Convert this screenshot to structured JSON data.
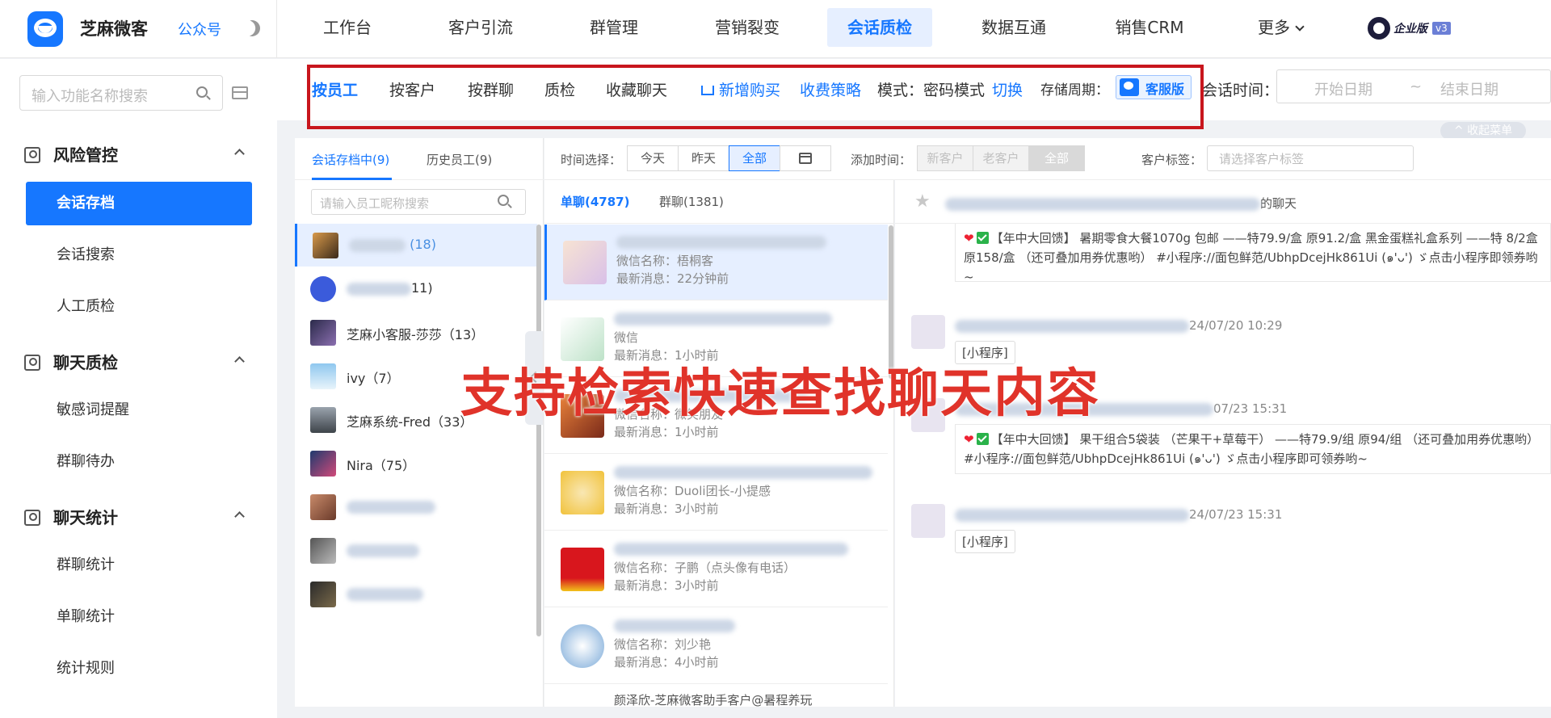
{
  "brand": {
    "name": "芝麻微客",
    "sub": "公众号"
  },
  "nav": {
    "items": [
      "工作台",
      "客户引流",
      "群管理",
      "营销裂变",
      "会话质检",
      "数据互通",
      "销售CRM",
      "更多"
    ],
    "active": "会话质检",
    "edition": "企业版",
    "version": "v3"
  },
  "sidebar": {
    "search_placeholder": "输入功能名称搜索",
    "sections": [
      {
        "title": "风险管控",
        "items": [
          "会话存档",
          "会话搜索",
          "人工质检"
        ]
      },
      {
        "title": "聊天质检",
        "items": [
          "敏感词提醒",
          "群聊待办"
        ]
      },
      {
        "title": "聊天统计",
        "items": [
          "群聊统计",
          "单聊统计",
          "统计规则"
        ]
      }
    ],
    "active_item": "会话存档"
  },
  "filterbar": {
    "tabs": [
      "按员工",
      "按客户",
      "按群聊",
      "质检",
      "收藏聊天"
    ],
    "active_tab": "按员工",
    "buy": "新增购买",
    "strategy": "收费策略",
    "mode_label": "模式：",
    "mode_value": "密码模式",
    "switch": "切换",
    "storage_label": "存储周期：",
    "storage_value": "客服版",
    "time_label": "会话时间：",
    "start_placeholder": "开始日期",
    "range_sep": "~",
    "end_placeholder": "结束日期",
    "collapse": "^ 收起菜单"
  },
  "staff": {
    "tabs": [
      "会话存档中(9)",
      "历史员工(9)"
    ],
    "search_placeholder": "请输入员工昵称搜索",
    "list": [
      {
        "name": "",
        "count": "(18)"
      },
      {
        "name": "",
        "count": "11)"
      },
      {
        "name": "芝麻小客服-莎莎",
        "count": "（13）"
      },
      {
        "name": "ivy",
        "count": "（7）"
      },
      {
        "name": "芝麻系统-Fred",
        "count": "（33）"
      },
      {
        "name": "Nira",
        "count": "（75）"
      },
      {
        "name": "",
        "count": ""
      },
      {
        "name": "",
        "count": ""
      },
      {
        "name": "",
        "count": ""
      }
    ]
  },
  "timebar": {
    "label": "时间选择：",
    "options": [
      "今天",
      "昨天",
      "全部"
    ],
    "active": "全部",
    "add_label": "添加时间：",
    "add_options": [
      "新客户",
      "老客户",
      "全部"
    ],
    "tag_label": "客户标签：",
    "tag_placeholder": "请选择客户标签"
  },
  "chats": {
    "tabs": [
      "单聊(4787)",
      "群聊(1381)"
    ],
    "list": [
      {
        "wx": "微信名称：梧桐客",
        "last": "最新消息：22分钟前"
      },
      {
        "wx": "微信",
        "last": "最新消息：1小时前"
      },
      {
        "wx": "微信名称：微笑朋友",
        "last": "最新消息：1小时前"
      },
      {
        "wx": "微信名称：Duoli团长-小提感",
        "last": "最新消息：3小时前"
      },
      {
        "wx": "微信名称：子鹏（点头像有电话）",
        "last": "最新消息：3小时前"
      },
      {
        "wx": "微信名称：刘少艳",
        "last": "最新消息：4小时前"
      },
      {
        "wx": "颜泽欣-芝麻微客助手客户@暑程养玩",
        "last": ""
      }
    ]
  },
  "conversation": {
    "title_suffix": "的聊天",
    "msg1": "【年中大回馈】 暑期零食大餐1070g 包邮 ——特79.9/盒 原91.2/盒 黑金蛋糕礼盒系列 ——特 8/2盒 原158/盒 （还可叠加用券优惠哟） #小程序://面包鲜范/UbhpDcejHk861Ui (๑'ᴗ') ゞ点击小程序即领券哟~",
    "time2": "24/07/20 10:29",
    "mini": "[小程序]",
    "time3": "07/23 15:31",
    "msg3": "【年中大回馈】 果干组合5袋装 （芒果干+草莓干） ——特79.9/组 原94/组 （还可叠加用券优惠哟） #小程序://面包鲜范/UbhpDcejHk861Ui (๑'ᴗ') ゞ点击小程序即可领券哟~",
    "time4": "24/07/23 15:31"
  },
  "overlay": "支持检索快速查找聊天内容",
  "colors": {
    "primary": "#1677ff",
    "highlight_box": "#c8161d",
    "overlay_text": "#e0332a"
  }
}
